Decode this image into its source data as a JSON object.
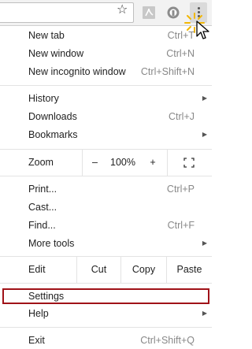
{
  "toolbar": {
    "icons": [
      "star-icon",
      "pdf-icon",
      "extension-icon",
      "menu-kebab-icon"
    ]
  },
  "menu": {
    "new_tab": {
      "label": "New tab",
      "shortcut": "Ctrl+T"
    },
    "new_window": {
      "label": "New window",
      "shortcut": "Ctrl+N"
    },
    "new_incognito": {
      "label": "New incognito window",
      "shortcut": "Ctrl+Shift+N"
    },
    "history": {
      "label": "History"
    },
    "downloads": {
      "label": "Downloads",
      "shortcut": "Ctrl+J"
    },
    "bookmarks": {
      "label": "Bookmarks"
    },
    "zoom": {
      "label": "Zoom",
      "minus": "–",
      "level": "100%",
      "plus": "+"
    },
    "print": {
      "label": "Print...",
      "shortcut": "Ctrl+P"
    },
    "cast": {
      "label": "Cast..."
    },
    "find": {
      "label": "Find...",
      "shortcut": "Ctrl+F"
    },
    "more_tools": {
      "label": "More tools"
    },
    "edit": {
      "label": "Edit",
      "cut": "Cut",
      "copy": "Copy",
      "paste": "Paste"
    },
    "settings": {
      "label": "Settings"
    },
    "help": {
      "label": "Help"
    },
    "exit": {
      "label": "Exit",
      "shortcut": "Ctrl+Shift+Q"
    }
  },
  "colors": {
    "highlight_border": "#a01218",
    "shortcut_text": "#888888",
    "separator": "#e3e3e3"
  }
}
